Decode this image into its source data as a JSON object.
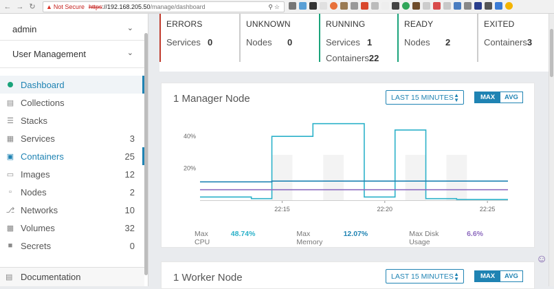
{
  "browser": {
    "warning": "Not Secure",
    "protocol": "https",
    "host": "://192.168.205.50",
    "path": "/manage/dashboard"
  },
  "sidebar": {
    "user": "admin",
    "user_management": "User Management",
    "items": [
      {
        "label": "Dashboard",
        "count": "",
        "icon": "dashboard-dot-icon"
      },
      {
        "label": "Collections",
        "count": "",
        "icon": "collections-icon"
      },
      {
        "label": "Stacks",
        "count": "",
        "icon": "stacks-icon"
      },
      {
        "label": "Services",
        "count": "3",
        "icon": "services-icon"
      },
      {
        "label": "Containers",
        "count": "25",
        "icon": "containers-icon"
      },
      {
        "label": "Images",
        "count": "12",
        "icon": "images-icon"
      },
      {
        "label": "Nodes",
        "count": "2",
        "icon": "nodes-icon"
      },
      {
        "label": "Networks",
        "count": "10",
        "icon": "networks-icon"
      },
      {
        "label": "Volumes",
        "count": "32",
        "icon": "volumes-icon"
      },
      {
        "label": "Secrets",
        "count": "0",
        "icon": "lock-icon"
      }
    ],
    "documentation": "Documentation"
  },
  "stats": [
    {
      "title": "ERRORS",
      "color": "#c0392b",
      "rows": [
        {
          "label": "Services",
          "value": "0"
        }
      ]
    },
    {
      "title": "UNKNOWN",
      "color": "#cccccc",
      "rows": [
        {
          "label": "Nodes",
          "value": "0"
        }
      ]
    },
    {
      "title": "RUNNING",
      "color": "#1aa37a",
      "rows": [
        {
          "label": "Services",
          "value": "1"
        },
        {
          "label": "Containers",
          "value": "22"
        }
      ]
    },
    {
      "title": "READY",
      "color": "#1aa37a",
      "rows": [
        {
          "label": "Nodes",
          "value": "2"
        }
      ]
    },
    {
      "title": "EXITED",
      "color": "#cccccc",
      "rows": [
        {
          "label": "Containers",
          "value": "3"
        }
      ]
    }
  ],
  "manager": {
    "title": "1 Manager Node",
    "time_range": "LAST 15 MINUTES",
    "toggle_max": "MAX",
    "toggle_avg": "AVG",
    "legend": [
      {
        "name": "Max CPU",
        "value": "48.74%",
        "color": "#2bb1c9"
      },
      {
        "name": "Max Memory",
        "value": "12.07%",
        "color": "#1f83b3"
      },
      {
        "name": "Max Disk Usage",
        "value": "6.6%",
        "color": "#8e6bbf"
      }
    ]
  },
  "worker": {
    "title": "1 Worker Node",
    "time_range": "LAST 15 MINUTES",
    "toggle_max": "MAX",
    "toggle_avg": "AVG"
  },
  "chart_data": {
    "type": "line",
    "title": "",
    "xlabel": "",
    "ylabel": "",
    "y_ticks": [
      "40%",
      "20%"
    ],
    "x_ticks": [
      "22:15",
      "22:20",
      "22:25"
    ],
    "ylim": [
      0,
      50
    ],
    "grid": false,
    "series": [
      {
        "name": "Max CPU",
        "color": "#2bb1c9",
        "x": [
          "22:11",
          "22:13.5",
          "22:13.5",
          "22:14.5",
          "22:14.5",
          "22:16.5",
          "22:16.5",
          "22:19",
          "22:19",
          "22:20.5",
          "22:20.5",
          "22:22",
          "22:22",
          "22:23.5",
          "22:23.5",
          "22:26"
        ],
        "values": [
          2,
          2,
          1,
          1,
          40,
          40,
          48,
          48,
          2,
          2,
          44,
          44,
          1,
          1,
          0.5,
          0.5
        ]
      },
      {
        "name": "Max Memory",
        "color": "#1f83b3",
        "x": [
          "22:11",
          "22:14.5",
          "22:14.5",
          "22:26"
        ],
        "values": [
          11.5,
          11.5,
          12,
          12
        ]
      },
      {
        "name": "Max Disk Usage",
        "color": "#8e6bbf",
        "x": [
          "22:11",
          "22:26"
        ],
        "values": [
          6.6,
          6.6
        ]
      }
    ]
  }
}
